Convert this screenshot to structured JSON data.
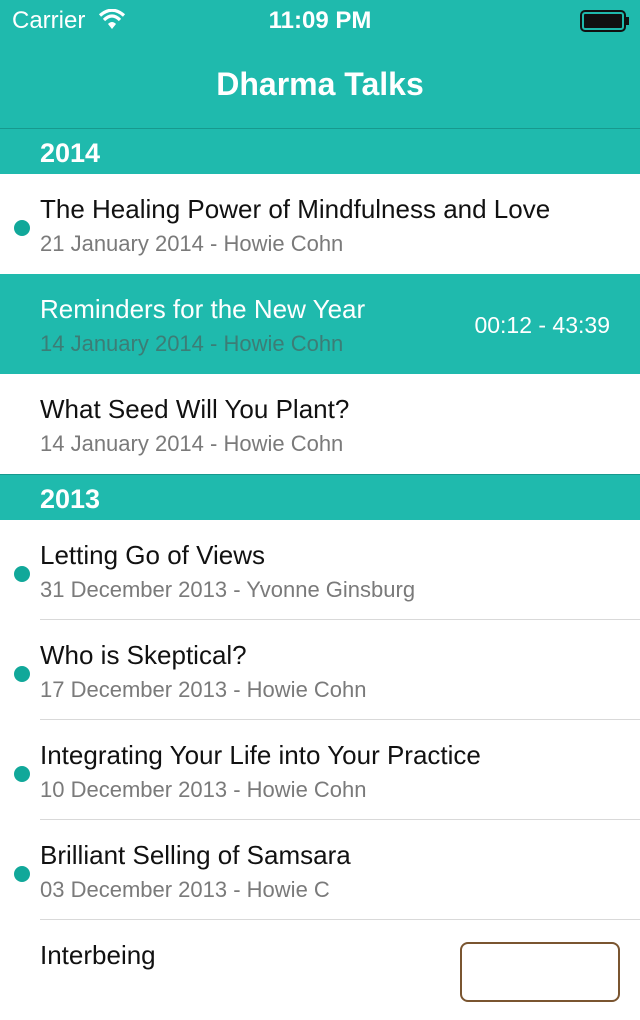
{
  "status_bar": {
    "carrier": "Carrier",
    "time": "11:09 PM",
    "wifi_icon": "wifi-icon",
    "battery_icon": "battery-icon"
  },
  "nav": {
    "title": "Dharma Talks"
  },
  "colors": {
    "accent": "#1fbaad",
    "dot": "#11a89a"
  },
  "sections": [
    {
      "year": "2014",
      "talks": [
        {
          "title": "The Healing Power of Mindfulness and Love",
          "subtitle": "21 January 2014 - Howie Cohn",
          "unplayed": true
        },
        {
          "title": "Reminders for the New Year",
          "subtitle": "14 January 2014 - Howie Cohn",
          "selected": true,
          "progress": "00:12 - 43:39"
        },
        {
          "title": "What Seed Will You Plant?",
          "subtitle": "14 January 2014 - Howie Cohn",
          "unplayed": false
        }
      ]
    },
    {
      "year": "2013",
      "talks": [
        {
          "title": "Letting Go of Views",
          "subtitle": "31 December 2013 - Yvonne Ginsburg",
          "unplayed": true
        },
        {
          "title": "Who is Skeptical?",
          "subtitle": "17 December 2013 - Howie Cohn",
          "unplayed": true
        },
        {
          "title": "Integrating Your Life into Your Practice",
          "subtitle": "10 December 2013 - Howie Cohn",
          "unplayed": true
        },
        {
          "title": "Brilliant Selling of Samsara",
          "subtitle": "03 December 2013 - Howie C",
          "unplayed": true
        },
        {
          "title": "Interbeing",
          "subtitle": ""
        }
      ]
    }
  ]
}
